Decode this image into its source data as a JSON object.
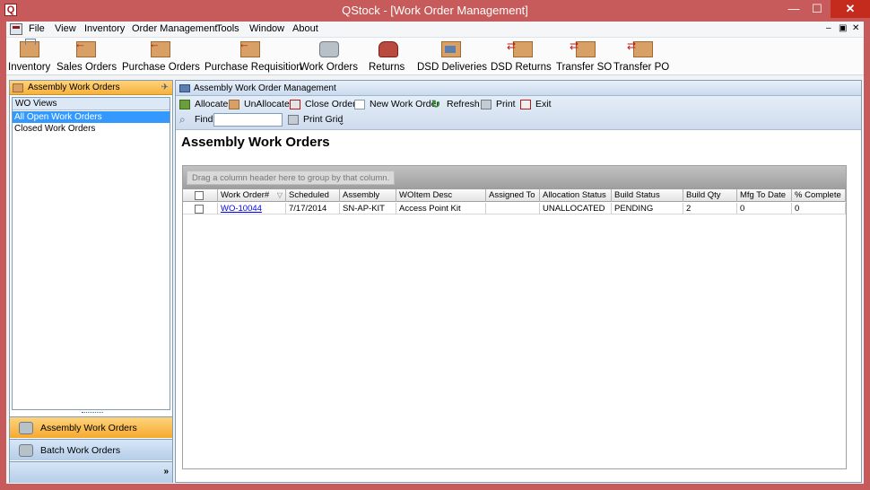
{
  "window": {
    "app_letter": "Q",
    "title": "QStock - [Work Order Management]",
    "minimize": "—",
    "maximize": "☐",
    "close": "✕"
  },
  "menu": {
    "items": [
      "File",
      "View",
      "Inventory",
      "Order Management",
      "Tools",
      "Window",
      "About"
    ],
    "mdi": {
      "minimize": "–",
      "restore": "▣",
      "close": "✕"
    }
  },
  "toolbar": {
    "buttons": [
      "Inventory",
      "Sales Orders",
      "Purchase Orders",
      "Purchase Requisition",
      "Work Orders",
      "Returns",
      "DSD Deliveries",
      "DSD Returns",
      "Transfer SO",
      "Transfer PO"
    ]
  },
  "nav": {
    "header": "Assembly Work Orders",
    "pin": "✈",
    "group": "WO Views",
    "items": [
      "All Open Work Orders",
      "Closed Work Orders"
    ],
    "selected_index": 0,
    "buttons": [
      "Assembly Work Orders",
      "Batch Work Orders"
    ],
    "active_button": 0,
    "footer_chevron": "»"
  },
  "main": {
    "header": "Assembly Work Order Management",
    "actions": [
      "Allocate",
      "UnAllocate",
      "Close Orders",
      "New Work Order",
      "Refresh",
      "Print",
      "Exit"
    ],
    "find_label": "Find",
    "find_value": "",
    "print_grid": "Print Grid",
    "overflow": "⌄",
    "title": "Assembly Work Orders"
  },
  "grid": {
    "group_hint": "Drag a column header here to group by that column.",
    "columns": [
      "",
      "Work Order#",
      "Scheduled",
      "Assembly",
      "WOItem Desc",
      "Assigned To",
      "Allocation Status",
      "Build Status",
      "Build Qty",
      "Mfg To Date",
      "% Complete"
    ],
    "sort_indicator": "▽",
    "rows": [
      {
        "work_order": "WO-10044",
        "scheduled": "7/17/2014",
        "assembly": "SN-AP-KIT",
        "desc": "Access Point Kit",
        "assigned_to": "",
        "allocation_status": "UNALLOCATED",
        "build_status": "PENDING",
        "build_qty": "2",
        "mfg_to_date": "0",
        "pct_complete": "0"
      }
    ]
  },
  "colors": {
    "frame": "#c75a5a",
    "accent_orange": "#f6b13c",
    "nav_blue": "#b5cde8",
    "selection": "#3399ff"
  }
}
